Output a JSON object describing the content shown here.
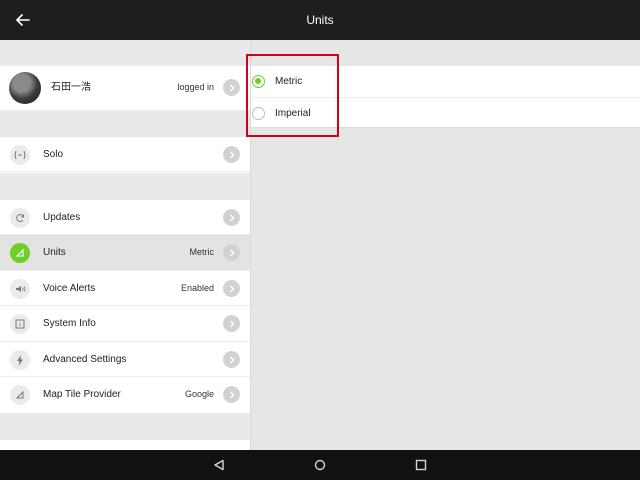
{
  "appbar": {
    "title": "Units",
    "back_icon": "arrow-left-icon"
  },
  "account": {
    "name": "石田一浩",
    "status": "logged in"
  },
  "groups": [
    {
      "items": [
        {
          "label": "Solo",
          "value": "",
          "icon": "solo-icon"
        }
      ]
    },
    {
      "items": [
        {
          "label": "Updates",
          "value": "",
          "icon": "refresh-icon"
        },
        {
          "label": "Units",
          "value": "Metric",
          "icon": "units-icon",
          "selected": true
        },
        {
          "label": "Voice Alerts",
          "value": "Enabled",
          "icon": "speaker-icon"
        },
        {
          "label": "System Info",
          "value": "",
          "icon": "info-icon"
        },
        {
          "label": "Advanced Settings",
          "value": "",
          "icon": "bolt-icon"
        },
        {
          "label": "Map Tile Provider",
          "value": "Google",
          "icon": "map-icon"
        }
      ]
    }
  ],
  "units_options": [
    {
      "label": "Metric",
      "checked": true
    },
    {
      "label": "Imperial",
      "checked": false
    }
  ],
  "colors": {
    "accent": "#6fcf2a",
    "appbar": "#1e1e1e",
    "highlight": "#d0021b"
  },
  "navbar": {
    "back_icon": "triangle-back-icon",
    "home_icon": "circle-home-icon",
    "recents_icon": "square-recents-icon"
  }
}
